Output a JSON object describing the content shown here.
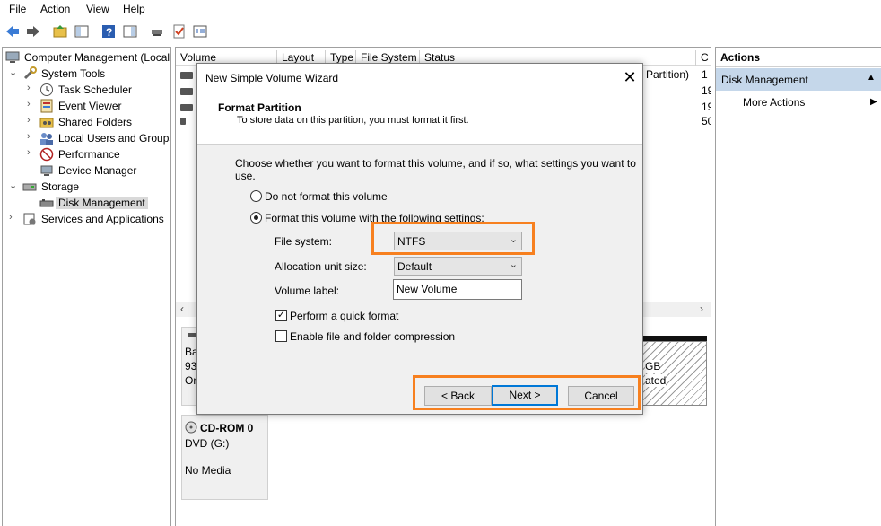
{
  "menu": {
    "items": [
      "File",
      "Action",
      "View",
      "Help"
    ]
  },
  "toolbar": {
    "icons": [
      "back-arrow-icon",
      "forward-arrow-icon",
      "up-folder-icon",
      "show-hide-tree-icon",
      "help-icon",
      "show-hide-action-pane-icon",
      "connect-icon",
      "check-icon",
      "properties-icon"
    ]
  },
  "tree": {
    "root": "Computer Management (Local",
    "system_tools": "System Tools",
    "task_scheduler": "Task Scheduler",
    "event_viewer": "Event Viewer",
    "shared_folders": "Shared Folders",
    "local_users": "Local Users and Groups",
    "performance": "Performance",
    "device_manager": "Device Manager",
    "storage": "Storage",
    "disk_management": "Disk Management",
    "services": "Services and Applications"
  },
  "volume_list": {
    "columns": [
      "Volume",
      "Layout",
      "Type",
      "File System",
      "Status",
      "C"
    ],
    "partition_text": "Partition)",
    "capacity_fragments": [
      "1",
      "1",
      "1",
      "5"
    ],
    "capacity_fragments_suffix": [
      "1!",
      "19",
      "19",
      "50"
    ]
  },
  "graph": {
    "disk0_label_lines": [
      "Ba",
      "93",
      "On"
    ],
    "unalloc_lines": [
      "GB",
      "ated"
    ],
    "cdrom_title": "CD-ROM 0",
    "cdrom_drive": "DVD (G:)",
    "cdrom_status": "No Media"
  },
  "actions": {
    "header": "Actions",
    "section": "Disk Management",
    "more": "More Actions"
  },
  "dialog": {
    "title": "New Simple Volume Wizard",
    "heading": "Format Partition",
    "subheading": "To store data on this partition, you must format it first.",
    "instruction": "Choose whether you want to format this volume, and if so, what settings you want to use.",
    "radio_no_format": "Do not format this volume",
    "radio_format": "Format this volume with the following settings:",
    "fs_label": "File system:",
    "fs_value": "NTFS",
    "alloc_label": "Allocation unit size:",
    "alloc_value": "Default",
    "vol_label_label": "Volume label:",
    "vol_label_value": "New Volume",
    "quick_format": "Perform a quick format",
    "compression": "Enable file and folder compression",
    "back_button": "< Back",
    "next_button": "Next >",
    "cancel_button": "Cancel",
    "highlight_color": "#f7801f"
  }
}
